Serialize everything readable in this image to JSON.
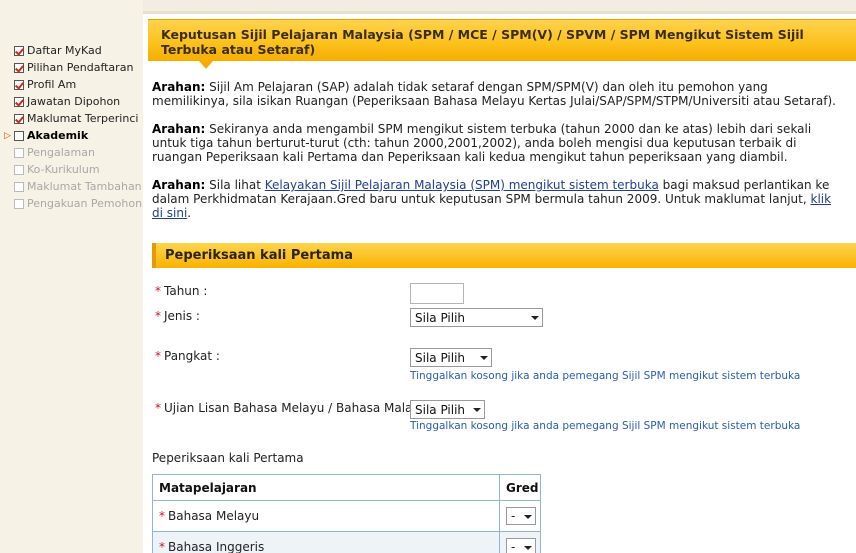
{
  "sidebar": {
    "items": [
      {
        "label": "Daftar MyKad",
        "state": "checked"
      },
      {
        "label": "Pilihan Pendaftaran",
        "state": "checked"
      },
      {
        "label": "Profil Am",
        "state": "checked"
      },
      {
        "label": "Jawatan Dipohon",
        "state": "checked"
      },
      {
        "label": "Maklumat Terperinci",
        "state": "checked"
      },
      {
        "label": "Akademik",
        "state": "active"
      },
      {
        "label": "Pengalaman",
        "state": "disabled"
      },
      {
        "label": "Ko-Kurikulum",
        "state": "disabled"
      },
      {
        "label": "Maklumat Tambahan",
        "state": "disabled"
      },
      {
        "label": "Pengakuan Pemohon",
        "state": "disabled"
      }
    ]
  },
  "header": {
    "title": "Keputusan Sijil Pelajaran Malaysia (SPM / MCE / SPM(V) / SPVM / SPM Mengikut Sistem Sijil Terbuka atau Setaraf)"
  },
  "instructions": {
    "p1_lead": "Arahan:",
    "p1_text": " Sijil Am Pelajaran (SAP) adalah tidak setaraf dengan SPM/SPM(V) dan oleh itu pemohon yang memilikinya, sila isikan Ruangan (Peperiksaan Bahasa Melayu Kertas Julai/SAP/SPM/STPM/Universiti atau Setaraf).",
    "p2_lead": "Arahan:",
    "p2_text": " Sekiranya anda mengambil SPM mengikut sistem terbuka (tahun 2000 dan ke atas) lebih dari sekali untuk tiga tahun berturut-turut (cth: tahun 2000,2001,2002), anda boleh mengisi dua keputusan terbaik di ruangan Peperiksaan kali Pertama dan Peperiksaan kali kedua mengikut tahun peperiksaan yang diambil.",
    "p3_lead": "Arahan:",
    "p3_pre": " Sila lihat ",
    "p3_link1": "Kelayakan Sijil Pelajaran Malaysia (SPM) mengikut sistem terbuka",
    "p3_mid": " bagi maksud perlantikan ke dalam Perkhidmatan Kerajaan.Gred baru untuk keputusan SPM bermula tahun 2009. Untuk maklumat lanjut, ",
    "p3_link2": "klik di sini",
    "p3_end": "."
  },
  "section": {
    "title": "Peperiksaan kali Pertama"
  },
  "form": {
    "required_mark": "*",
    "tahun_label": "Tahun :",
    "tahun_value": "",
    "jenis_label": "Jenis :",
    "jenis_value": "Sila Pilih",
    "pangkat_label": "Pangkat :",
    "pangkat_value": "Sila Pilih",
    "pangkat_hint": "Tinggalkan kosong jika anda pemegang Sijil SPM mengikut sistem terbuka",
    "ujian_label": "Ujian Lisan Bahasa Melayu / Bahasa Malaysia :",
    "ujian_value": "Sila Pilih",
    "ujian_hint": "Tinggalkan kosong jika anda pemegang Sijil SPM mengikut sistem terbuka"
  },
  "results": {
    "label": "Peperiksaan kali Pertama",
    "headers": [
      "Matapelajaran",
      "Gred"
    ],
    "rows": [
      {
        "subject": "Bahasa Melayu",
        "grade": "-"
      },
      {
        "subject": "Bahasa Inggeris",
        "grade": "-"
      }
    ]
  }
}
